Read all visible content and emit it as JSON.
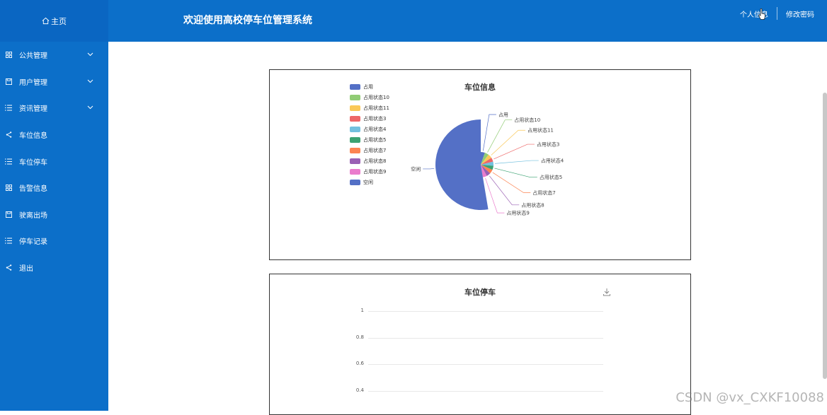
{
  "header": {
    "home_label": "主页",
    "title": "欢迎使用高校停车位管理系统",
    "profile_link": "个人信息",
    "password_link": "修改密码"
  },
  "sidebar": {
    "items": [
      {
        "label": "公共管理",
        "icon": "grid-icon",
        "expandable": true
      },
      {
        "label": "用户管理",
        "icon": "save-icon",
        "expandable": true
      },
      {
        "label": "资讯管理",
        "icon": "list-icon",
        "expandable": true
      },
      {
        "label": "车位信息",
        "icon": "share-icon",
        "expandable": false
      },
      {
        "label": "车位停车",
        "icon": "list-icon",
        "expandable": false
      },
      {
        "label": "告警信息",
        "icon": "grid-icon",
        "expandable": false
      },
      {
        "label": "驶离出场",
        "icon": "save-icon",
        "expandable": false
      },
      {
        "label": "停车记录",
        "icon": "list-icon",
        "expandable": false
      },
      {
        "label": "退出",
        "icon": "share-icon",
        "expandable": false
      }
    ]
  },
  "chart_data": [
    {
      "type": "pie",
      "title": "车位信息",
      "rose": true,
      "labels": [
        "占用",
        "占用状态10",
        "占用状态11",
        "占用状态3",
        "占用状态4",
        "占用状态5",
        "占用状态7",
        "占用状态8",
        "占用状态9",
        "空闲"
      ],
      "values": [
        1,
        1,
        1,
        1,
        1,
        1,
        1,
        1,
        1,
        10
      ],
      "colors": [
        "#5470c6",
        "#91cc75",
        "#fac858",
        "#ee6666",
        "#73c0de",
        "#3ba272",
        "#fc8452",
        "#9a60b4",
        "#ea7ccc",
        "#5470c6"
      ],
      "legend_position": "top-left"
    },
    {
      "type": "bar",
      "title": "车位停车",
      "categories": [],
      "values": [],
      "yticks": [
        "1",
        "0.8",
        "0.6",
        "0.4"
      ],
      "grid": true
    }
  ],
  "toolbox": {
    "download_icon": "download-icon"
  },
  "watermark": "CSDN @vx_CXKF10088"
}
